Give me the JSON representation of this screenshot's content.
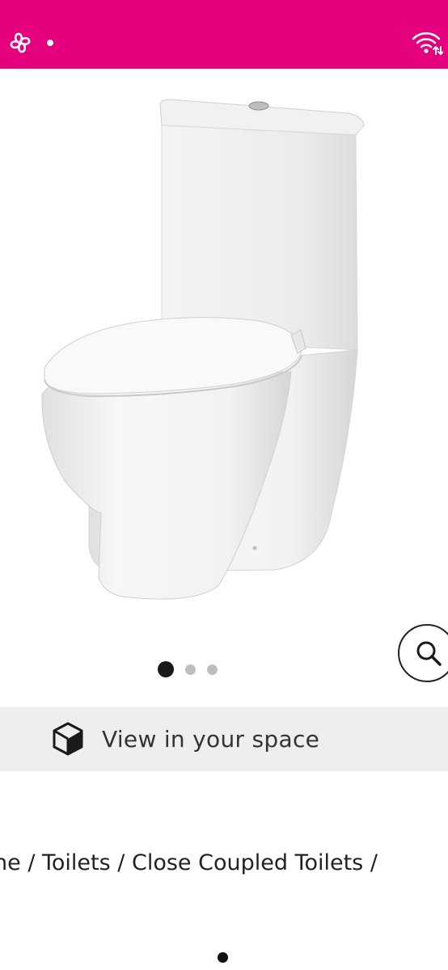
{
  "status_bar": {
    "bg_color": "#e5007d",
    "left_icons": [
      "pinwheel-icon",
      "notification-dot"
    ],
    "right_icons": [
      "wifi-icon"
    ]
  },
  "product": {
    "image_description_icon": "toilet-image",
    "zoom_icon": "magnifier-icon"
  },
  "carousel": {
    "total": 3,
    "active_index": 0
  },
  "ar": {
    "label": "View in your space",
    "icon": "cube-icon"
  },
  "breadcrumb": {
    "items": [
      "ne",
      "Toilets",
      "Close Coupled Toilets",
      ""
    ],
    "separator": " / "
  }
}
